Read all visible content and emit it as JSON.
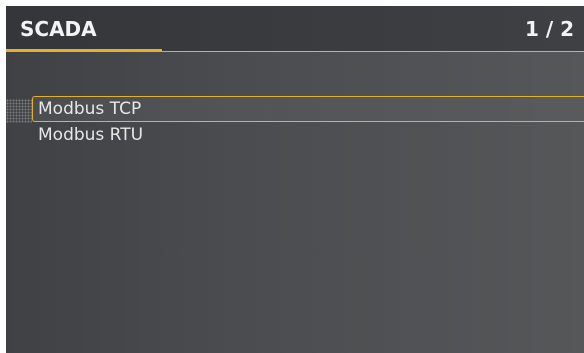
{
  "header": {
    "title": "SCADA",
    "page_indicator": "1 / 2"
  },
  "menu": {
    "items": [
      {
        "label": "Modbus TCP",
        "selected": true
      },
      {
        "label": "Modbus RTU",
        "selected": false
      }
    ]
  },
  "colors": {
    "accent": "#e0b42a",
    "background": "#4a4c4f",
    "text": "#e7e7e7"
  }
}
